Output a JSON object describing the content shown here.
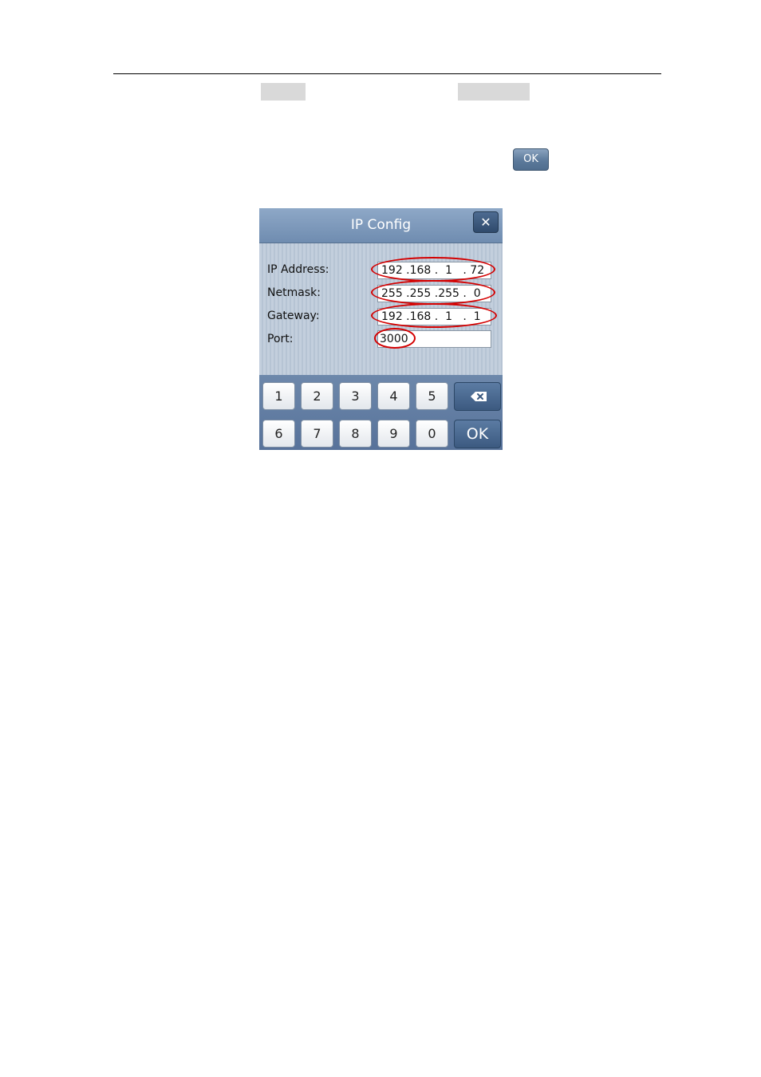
{
  "toolbar": {
    "ok_label": "OK"
  },
  "dialog": {
    "title": "IP Config",
    "close_icon": "close-icon",
    "fields": {
      "ip_address": {
        "label": "IP Address:",
        "value": "192 .168 .  1   . 72"
      },
      "netmask": {
        "label": "Netmask:",
        "value": "255 .255 .255 .  0"
      },
      "gateway": {
        "label": "Gateway:",
        "value": "192 .168 .  1   .  1"
      },
      "port": {
        "label": "Port:",
        "value": "3000"
      }
    },
    "keypad": {
      "keys_row1": [
        "1",
        "2",
        "3",
        "4",
        "5"
      ],
      "keys_row2": [
        "6",
        "7",
        "8",
        "9",
        "0"
      ],
      "backspace_icon": "backspace-icon",
      "ok_label": "OK"
    }
  },
  "colors": {
    "highlight_oval": "#d40000",
    "titlebar": "#7f9abd",
    "keypad_bg": "#6480a6"
  }
}
